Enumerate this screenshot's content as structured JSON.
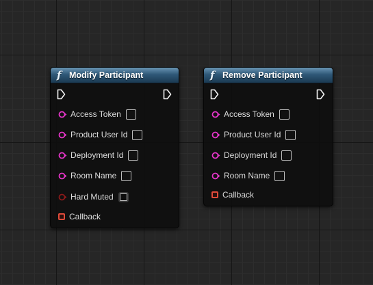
{
  "colors": {
    "string_pin": "#e535c8",
    "bool_pin": "#8c1a1a",
    "delegate_pin": "#e04b3a",
    "header_accent": "#2f5878"
  },
  "nodes": {
    "modify": {
      "title": "Modify Participant",
      "icon": "function-icon",
      "pins": {
        "access_token": "Access Token",
        "product_user_id": "Product User Id",
        "deployment_id": "Deployment Id",
        "room_name": "Room Name",
        "hard_muted": "Hard Muted",
        "callback": "Callback"
      }
    },
    "remove": {
      "title": "Remove Participant",
      "icon": "function-icon",
      "pins": {
        "access_token": "Access Token",
        "product_user_id": "Product User Id",
        "deployment_id": "Deployment Id",
        "room_name": "Room Name",
        "callback": "Callback"
      }
    }
  }
}
